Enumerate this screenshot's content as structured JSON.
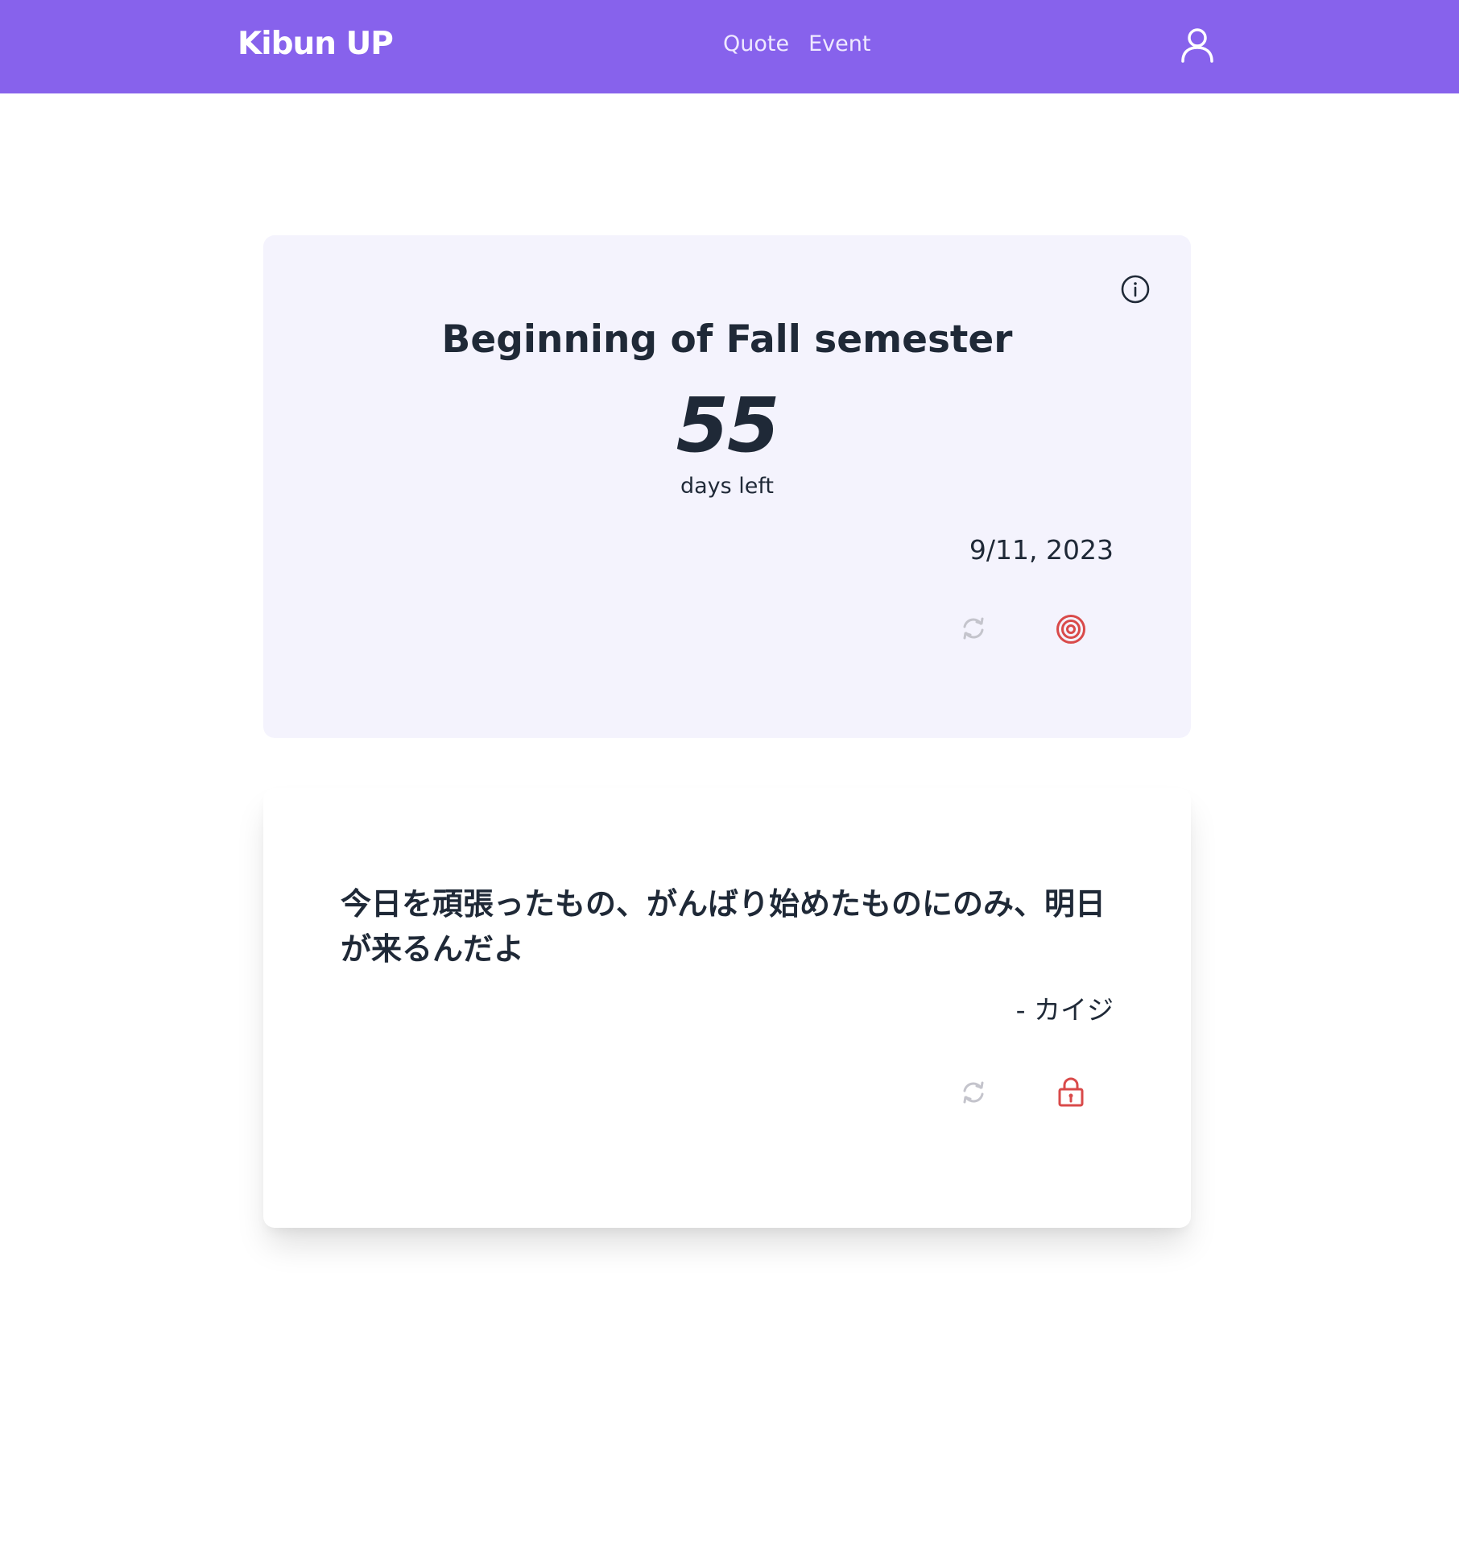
{
  "navbar": {
    "brand": "Kibun UP",
    "links": [
      "Quote",
      "Event"
    ],
    "user_icon": "user-icon",
    "background_color": "#8762ec"
  },
  "event_card": {
    "title": "Beginning of Fall semester",
    "days_count": "55",
    "days_label": "days left",
    "date": "9/11, 2023",
    "info_icon": "info-icon",
    "refresh_icon": "refresh-icon",
    "target_icon": "target-icon",
    "accent_color": "#d94a4a",
    "background_color": "#f4f3fd"
  },
  "quote_card": {
    "text": "今日を頑張ったもの、がんばり始めたものにのみ、明日が来るんだよ",
    "author": "- カイジ",
    "refresh_icon": "refresh-icon",
    "lock_icon": "lock-icon"
  }
}
